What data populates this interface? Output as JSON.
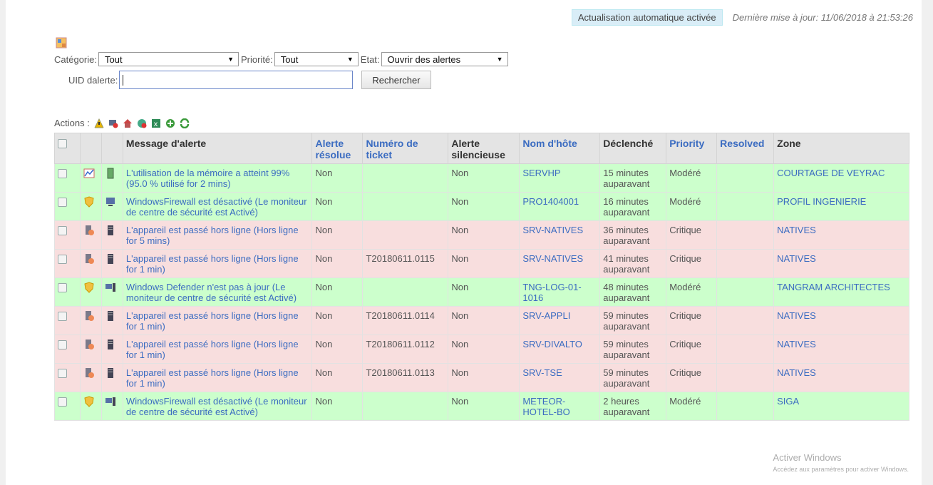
{
  "header": {
    "auto_refresh": "Actualisation automatique activée",
    "last_update": "Dernière mise à jour: 11/06/2018 à 21:53:26"
  },
  "filters": {
    "category_label": "Catégorie:",
    "category_value": "Tout",
    "priority_label": "Priorité:",
    "priority_value": "Tout",
    "state_label": "Etat:",
    "state_value": "Ouvrir des alertes",
    "uid_label": "UID dalerte:",
    "uid_value": "",
    "search_button": "Rechercher"
  },
  "actions": {
    "label": "Actions :",
    "icons": [
      "warning-icon",
      "monitor-delete-icon",
      "home-alert-icon",
      "resolve-icon",
      "export-icon",
      "add-icon",
      "refresh-icon"
    ]
  },
  "table": {
    "columns": [
      "",
      "",
      "",
      "Message d'alerte",
      "Alerte résolue",
      "Numéro de ticket",
      "Alerte silencieuse",
      "Nom d'hôte",
      "Déclenché",
      "Priority",
      "Resolved",
      "Zone"
    ],
    "rows": [
      {
        "status": "green",
        "type_icon": "memory-chart-icon",
        "device_icon": "server-green-icon",
        "message": "L'utilisation de la mémoire a atteint 99% (95.0 % utilisé for 2 mins)",
        "resolved": "Non",
        "ticket": "",
        "silent": "Non",
        "host": "SERVHP",
        "triggered": "15 minutes auparavant",
        "priority": "Modéré",
        "resolved2": "",
        "zone": "COURTAGE DE VEYRAC"
      },
      {
        "status": "green",
        "type_icon": "shield-icon",
        "device_icon": "computer-icon",
        "message": "WindowsFirewall est désactivé (Le moniteur de centre de sécurité est Activé)",
        "resolved": "Non",
        "ticket": "",
        "silent": "Non",
        "host": "PRO1404001",
        "triggered": "16 minutes auparavant",
        "priority": "Modéré",
        "resolved2": "",
        "zone": "PROFIL INGENIERIE"
      },
      {
        "status": "red",
        "type_icon": "offline-icon",
        "device_icon": "server-icon",
        "message": "L'appareil est passé hors ligne (Hors ligne for 5 mins)",
        "resolved": "Non",
        "ticket": "",
        "silent": "Non",
        "host": "SRV-NATIVES",
        "triggered": "36 minutes auparavant",
        "priority": "Critique",
        "resolved2": "",
        "zone": "NATIVES"
      },
      {
        "status": "red",
        "type_icon": "offline-icon",
        "device_icon": "server-icon",
        "message": "L'appareil est passé hors ligne (Hors ligne for 1 min)",
        "resolved": "Non",
        "ticket": "T20180611.0115",
        "silent": "Non",
        "host": "SRV-NATIVES",
        "triggered": "41 minutes auparavant",
        "priority": "Critique",
        "resolved2": "",
        "zone": "NATIVES"
      },
      {
        "status": "green",
        "type_icon": "shield-icon",
        "device_icon": "workstation-icon",
        "message": "Windows Defender n'est pas à jour (Le moniteur de centre de sécurité est Activé)",
        "resolved": "Non",
        "ticket": "",
        "silent": "Non",
        "host": "TNG-LOG-01-1016",
        "triggered": "48 minutes auparavant",
        "priority": "Modéré",
        "resolved2": "",
        "zone": "TANGRAM ARCHITECTES"
      },
      {
        "status": "red",
        "type_icon": "offline-icon",
        "device_icon": "server-icon",
        "message": "L'appareil est passé hors ligne (Hors ligne for 1 min)",
        "resolved": "Non",
        "ticket": "T20180611.0114",
        "silent": "Non",
        "host": "SRV-APPLI",
        "triggered": "59 minutes auparavant",
        "priority": "Critique",
        "resolved2": "",
        "zone": "NATIVES"
      },
      {
        "status": "red",
        "type_icon": "offline-icon",
        "device_icon": "server-icon",
        "message": "L'appareil est passé hors ligne (Hors ligne for 1 min)",
        "resolved": "Non",
        "ticket": "T20180611.0112",
        "silent": "Non",
        "host": "SRV-DIVALTO",
        "triggered": "59 minutes auparavant",
        "priority": "Critique",
        "resolved2": "",
        "zone": "NATIVES"
      },
      {
        "status": "red",
        "type_icon": "offline-icon",
        "device_icon": "server-icon",
        "message": "L'appareil est passé hors ligne (Hors ligne for 1 min)",
        "resolved": "Non",
        "ticket": "T20180611.0113",
        "silent": "Non",
        "host": "SRV-TSE",
        "triggered": "59 minutes auparavant",
        "priority": "Critique",
        "resolved2": "",
        "zone": "NATIVES"
      },
      {
        "status": "green",
        "type_icon": "shield-icon",
        "device_icon": "workstation-icon",
        "message": "WindowsFirewall est désactivé (Le moniteur de centre de sécurité est Activé)",
        "resolved": "Non",
        "ticket": "",
        "silent": "Non",
        "host": "METEOR-HOTEL-BO",
        "triggered": "2 heures auparavant",
        "priority": "Modéré",
        "resolved2": "",
        "zone": "SIGA"
      }
    ]
  },
  "watermark": {
    "title": "Activer Windows",
    "subtitle": "Accédez aux paramètres pour activer Windows."
  }
}
